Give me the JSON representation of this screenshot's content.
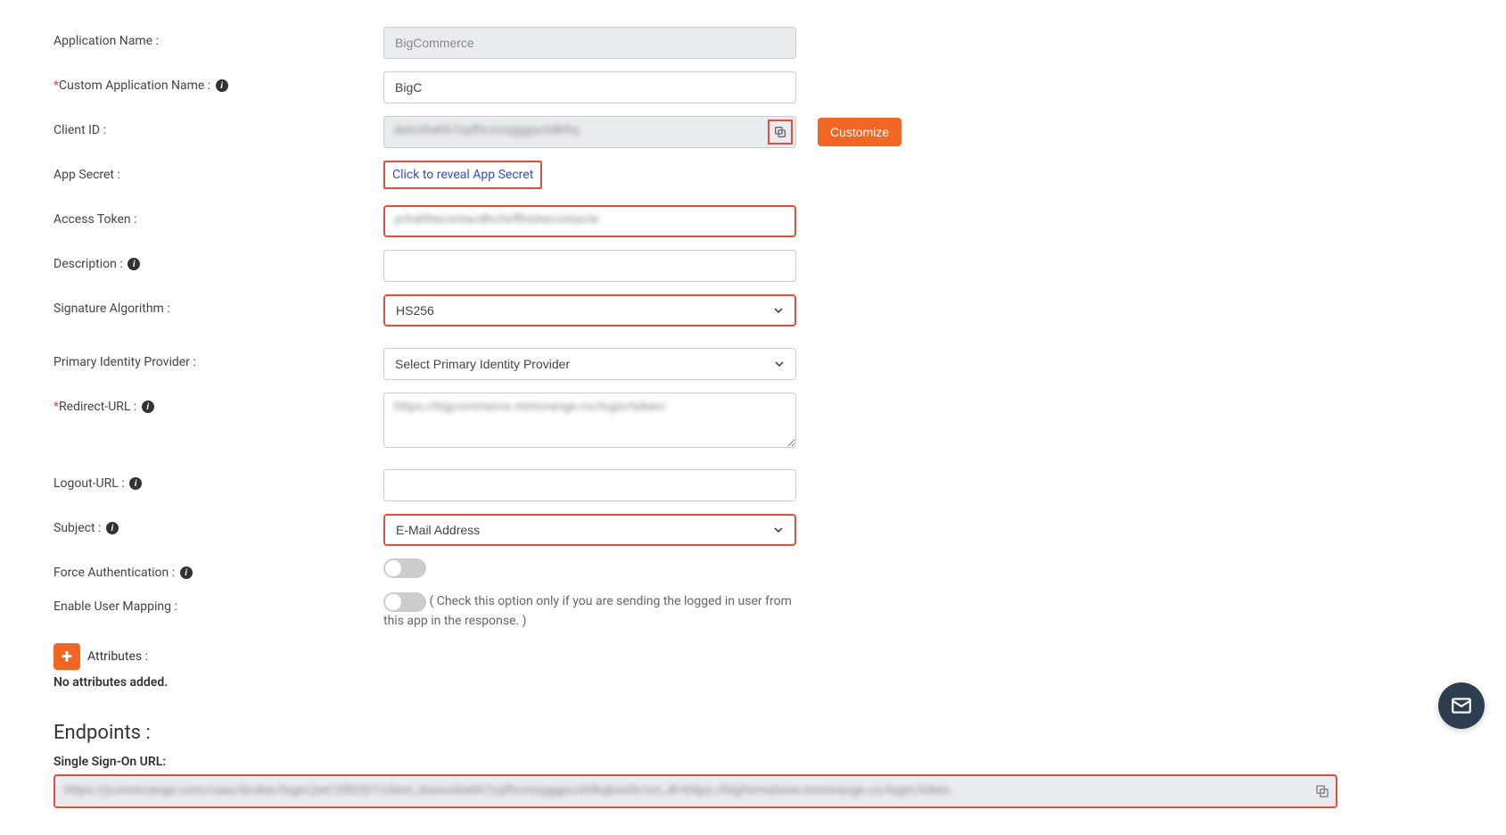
{
  "form": {
    "applicationName": {
      "label": "Application Name :",
      "value": "BigCommerce"
    },
    "customApplicationName": {
      "label": "Custom Application Name :",
      "value": "BigC"
    },
    "clientId": {
      "label": "Client ID :",
      "value": "████████████████████████"
    },
    "appSecret": {
      "label": "App Secret :",
      "linkText": "Click to reveal App Secret"
    },
    "accessToken": {
      "label": "Access Token :",
      "value": "████████████████████████████████"
    },
    "description": {
      "label": "Description :",
      "value": ""
    },
    "signatureAlgorithm": {
      "label": "Signature Algorithm :",
      "value": "HS256"
    },
    "primaryIdentityProvider": {
      "label": "Primary Identity Provider :",
      "value": "Select Primary Identity Provider"
    },
    "redirectUrl": {
      "label": "Redirect-URL :",
      "value": "https://██████████████████████████"
    },
    "logoutUrl": {
      "label": "Logout-URL :",
      "value": ""
    },
    "subject": {
      "label": "Subject :",
      "value": "E-Mail Address"
    },
    "forceAuthentication": {
      "label": "Force Authentication :"
    },
    "enableUserMapping": {
      "label": "Enable User Mapping :",
      "helpText": "( Check this option only if you are sending the logged in user from this app in the response. )"
    },
    "attributes": {
      "label": "Attributes :",
      "emptyText": "No attributes added."
    },
    "customizeButton": "Customize"
  },
  "endpoints": {
    "heading": "Endpoints :",
    "ssoUrl": {
      "label": "Single Sign-On URL:",
      "value": "https://█████████████████████████████████████████████████████████████████████████████████████████████████████████████████████"
    }
  }
}
